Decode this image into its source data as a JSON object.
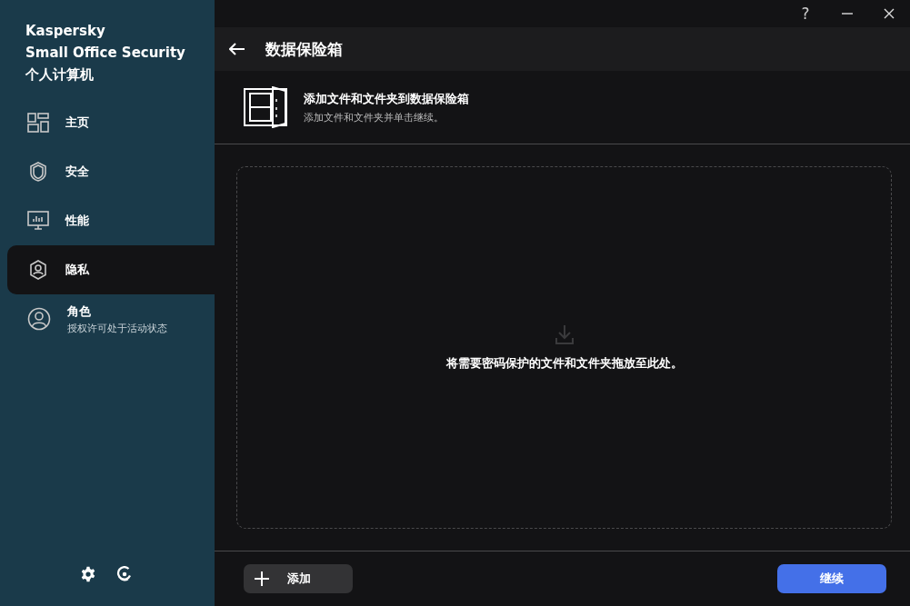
{
  "sidebar": {
    "brand": [
      "Kaspersky",
      "Small Office Security",
      "个人计算机"
    ],
    "items": [
      {
        "kind": "home",
        "label": "主页",
        "selected": false
      },
      {
        "kind": "shield",
        "label": "安全",
        "selected": false
      },
      {
        "kind": "monitor",
        "label": "性能",
        "selected": false
      },
      {
        "kind": "privacy",
        "label": "隐私",
        "selected": true
      },
      {
        "kind": "profile",
        "label": "角色",
        "subtitle": "授权许可处于活动状态",
        "selected": false
      }
    ]
  },
  "titlebar": {
    "help": "?"
  },
  "header": {
    "title": "数据保险箱"
  },
  "info": {
    "title": "添加文件和文件夹到数据保险箱",
    "subtitle": "添加文件和文件夹并单击继续。"
  },
  "dropzone": {
    "text": "将需要密码保护的文件和文件夹拖放至此处。"
  },
  "footer": {
    "add": "添加",
    "continue": "继续"
  }
}
